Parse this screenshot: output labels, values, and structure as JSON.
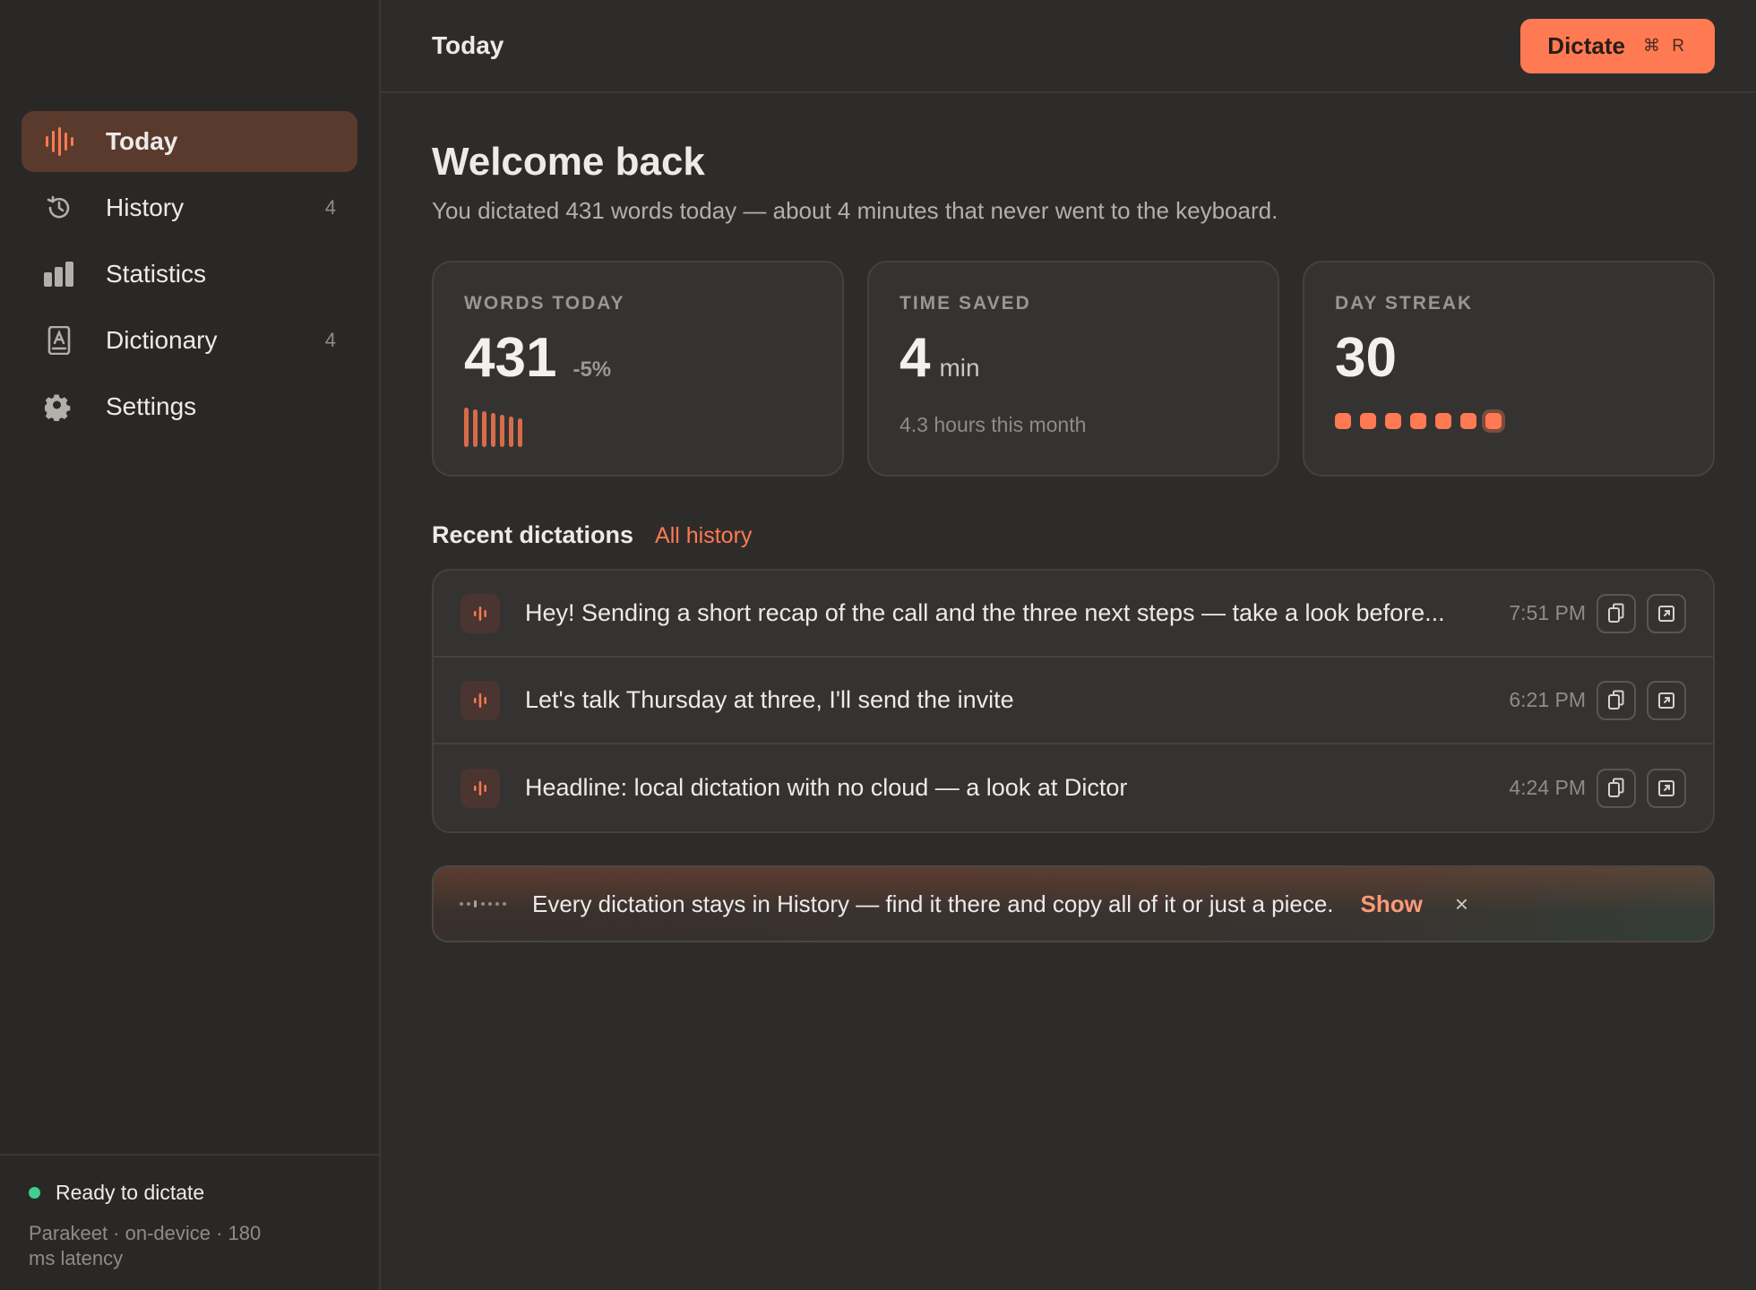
{
  "sidebar": {
    "items": [
      {
        "label": "Today",
        "count": "",
        "icon": "waveform-icon",
        "active": true
      },
      {
        "label": "History",
        "count": "4",
        "icon": "history-icon"
      },
      {
        "label": "Statistics",
        "count": "",
        "icon": "bar-chart-icon"
      },
      {
        "label": "Dictionary",
        "count": "4",
        "icon": "dictionary-icon"
      },
      {
        "label": "Settings",
        "count": "",
        "icon": "gear-icon"
      }
    ],
    "status": "Ready to dictate",
    "status_color": "#3fcf8e",
    "model_info": "Parakeet · on-device · 180 ms latency"
  },
  "topbar": {
    "title": "Today",
    "dictate_label": "Dictate",
    "dictate_shortcut": "⌘ R"
  },
  "welcome": {
    "title": "Welcome back",
    "subtitle": "You dictated 431 words today — about 4 minutes that never went to the keyboard."
  },
  "cards": {
    "words": {
      "label": "WORDS TODAY",
      "value": "431",
      "delta": "-5%"
    },
    "time": {
      "label": "TIME SAVED",
      "value": "4",
      "unit": "min",
      "note": "4.3 hours this month"
    },
    "streak": {
      "label": "DAY STREAK",
      "value": "30",
      "dots_shown": 7
    }
  },
  "recent": {
    "title": "Recent dictations",
    "link": "All history",
    "items": [
      {
        "text": "Hey! Sending a short recap of the call and the three next steps — take a look before...",
        "time": "7:51 PM"
      },
      {
        "text": "Let's talk Thursday at three, I'll send the invite",
        "time": "6:21 PM"
      },
      {
        "text": "Headline: local dictation with no cloud — a look at Dictor",
        "time": "4:24 PM"
      }
    ]
  },
  "banner": {
    "text": "Every dictation stays in History — find it there and copy all of it or just a piece.",
    "action": "Show",
    "close": "×"
  },
  "colors": {
    "accent": "#ff7a52",
    "background": "#2e2c2b",
    "sidebar": "#2a2827"
  }
}
